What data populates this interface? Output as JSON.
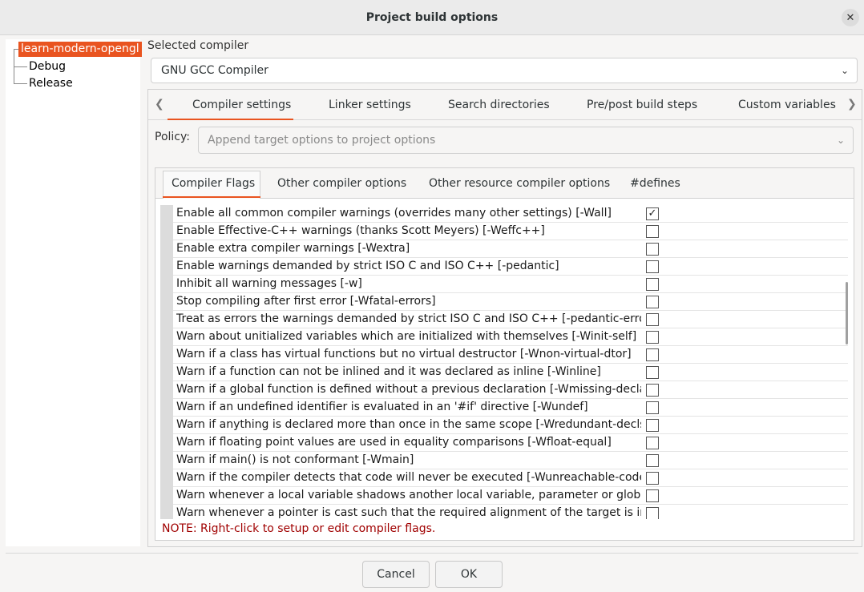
{
  "window": {
    "title": "Project build options",
    "close_glyph": "✕"
  },
  "tree": {
    "root": "learn-modern-opengl",
    "children": [
      "Debug",
      "Release"
    ]
  },
  "compiler": {
    "label": "Selected compiler",
    "value": "GNU GCC Compiler"
  },
  "outer_tabs": {
    "items": [
      "Compiler settings",
      "Linker settings",
      "Search directories",
      "Pre/post build steps",
      "Custom variables"
    ],
    "active": "Compiler settings"
  },
  "policy": {
    "label": "Policy:",
    "placeholder": "Append target options to project options"
  },
  "inner_tabs": {
    "items": [
      "Compiler Flags",
      "Other compiler options",
      "Other resource compiler options",
      "#defines"
    ],
    "active": "Compiler Flags"
  },
  "flags": [
    {
      "text": "Enable all common compiler warnings (overrides many other settings)  [-Wall]",
      "checked": true
    },
    {
      "text": "Enable Effective-C++ warnings (thanks Scott Meyers)  [-Weffc++]",
      "checked": false
    },
    {
      "text": "Enable extra compiler warnings  [-Wextra]",
      "checked": false
    },
    {
      "text": "Enable warnings demanded by strict ISO C and ISO C++  [-pedantic]",
      "checked": false
    },
    {
      "text": "Inhibit all warning messages  [-w]",
      "checked": false
    },
    {
      "text": "Stop compiling after first error  [-Wfatal-errors]",
      "checked": false
    },
    {
      "text": "Treat as errors the warnings demanded by strict ISO C and ISO C++  [-pedantic-errors]",
      "checked": false
    },
    {
      "text": "Warn about unitialized variables which are initialized with themselves  [-Winit-self]",
      "checked": false
    },
    {
      "text": "Warn if a class has virtual functions but no virtual destructor  [-Wnon-virtual-dtor]",
      "checked": false
    },
    {
      "text": "Warn if a function can not be inlined and it was declared as inline  [-Winline]",
      "checked": false
    },
    {
      "text": "Warn if a global function is defined without a previous declaration  [-Wmissing-declarati",
      "checked": false
    },
    {
      "text": "Warn if an undefined identifier is evaluated in an '#if' directive  [-Wundef]",
      "checked": false
    },
    {
      "text": "Warn if anything is declared more than once in the same scope  [-Wredundant-decls]",
      "checked": false
    },
    {
      "text": "Warn if floating point values are used in equality comparisons  [-Wfloat-equal]",
      "checked": false
    },
    {
      "text": "Warn if main() is not conformant  [-Wmain]",
      "checked": false
    },
    {
      "text": "Warn if the compiler detects that code will never be executed  [-Wunreachable-code]",
      "checked": false
    },
    {
      "text": "Warn whenever a local variable shadows another local variable, parameter or global var",
      "checked": false
    },
    {
      "text": "Warn whenever a pointer is cast such that the required alignment of the target is increas",
      "checked": false
    }
  ],
  "note": "NOTE: Right-click to setup or edit compiler flags.",
  "buttons": {
    "cancel": "Cancel",
    "ok": "OK"
  },
  "colors": {
    "accent": "#e95420",
    "note": "#a00000"
  }
}
